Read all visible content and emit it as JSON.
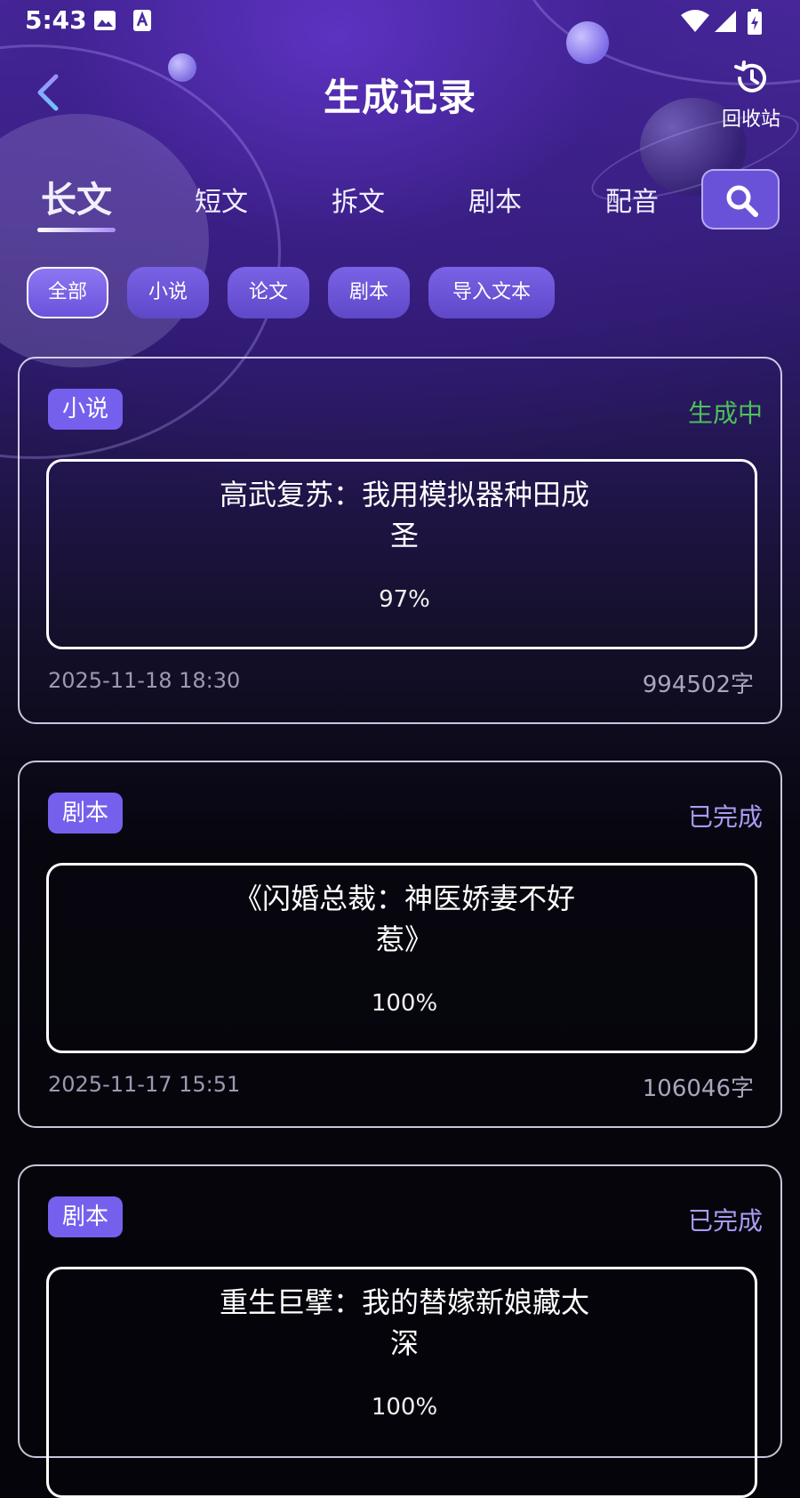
{
  "status_bar": {
    "time": "5:43"
  },
  "header": {
    "title": "生成记录",
    "recycle_label": "回收站"
  },
  "tabs": [
    {
      "label": "长文",
      "active": true
    },
    {
      "label": "短文",
      "active": false
    },
    {
      "label": "拆文",
      "active": false
    },
    {
      "label": "剧本",
      "active": false
    },
    {
      "label": "配音",
      "active": false
    }
  ],
  "filters": [
    {
      "label": "全部",
      "active": true
    },
    {
      "label": "小说",
      "active": false
    },
    {
      "label": "论文",
      "active": false
    },
    {
      "label": "剧本",
      "active": false
    },
    {
      "label": "导入文本",
      "active": false
    }
  ],
  "records": [
    {
      "tag": "小说",
      "status": "生成中",
      "status_color": "#4cc05a",
      "title_line1": "高武复苏：我用模拟器种田成",
      "title_line2": "圣",
      "progress": "97%",
      "date": "2025-11-18 18:30",
      "words": "994502字"
    },
    {
      "tag": "剧本",
      "status": "已完成",
      "status_color": "#a89cf4",
      "title_line1": "《闪婚总裁：神医娇妻不好",
      "title_line2": "惹》",
      "progress": "100%",
      "date": "2025-11-17 15:51",
      "words": "106046字"
    },
    {
      "tag": "剧本",
      "status": "已完成",
      "status_color": "#a89cf4",
      "title_line1": "重生巨擘：我的替嫁新娘藏太",
      "title_line2": "深",
      "progress": "100%",
      "date": "",
      "words": ""
    }
  ],
  "colors": {
    "accent": "#7560ee",
    "generating": "#4cc05a",
    "done": "#a89cf4"
  }
}
